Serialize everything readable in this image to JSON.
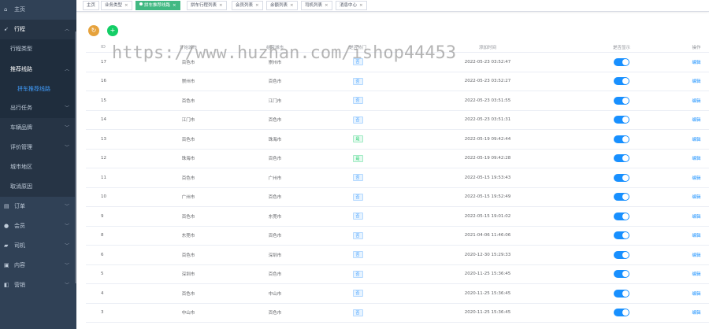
{
  "sidebar": {
    "items": [
      {
        "label": "主页",
        "icon": "home-icon",
        "chev": ""
      },
      {
        "label": "行程",
        "icon": "send-icon",
        "chev": "^"
      },
      {
        "label": "行程类型",
        "icon": "",
        "chev": ""
      },
      {
        "label": "推荐线路",
        "icon": "",
        "chev": "^"
      },
      {
        "label": "拼车推荐线路",
        "icon": "",
        "chev": ""
      },
      {
        "label": "出行任务",
        "icon": "",
        "chev": "v"
      },
      {
        "label": "车辆品牌",
        "icon": "",
        "chev": "v"
      },
      {
        "label": "评价管理",
        "icon": "",
        "chev": "v"
      },
      {
        "label": "城市地区",
        "icon": "",
        "chev": ""
      },
      {
        "label": "取消原因",
        "icon": "",
        "chev": ""
      },
      {
        "label": "订单",
        "icon": "order-icon",
        "chev": "v"
      },
      {
        "label": "会员",
        "icon": "user-icon",
        "chev": "v"
      },
      {
        "label": "司机",
        "icon": "driver-icon",
        "chev": "v"
      },
      {
        "label": "内容",
        "icon": "content-icon",
        "chev": "v"
      },
      {
        "label": "营销",
        "icon": "marketing-icon",
        "chev": "v"
      }
    ]
  },
  "tags": [
    {
      "label": "主页",
      "close": ""
    },
    {
      "label": "业务类型",
      "close": "×"
    },
    {
      "label": "拼车推荐线路",
      "close": "×"
    },
    {
      "label": "拼车行程列表",
      "close": "×"
    },
    {
      "label": "会员列表",
      "close": "×"
    },
    {
      "label": "余额列表",
      "close": "×"
    },
    {
      "label": "司机列表",
      "close": "×"
    },
    {
      "label": "消息中心",
      "close": "×"
    }
  ],
  "toolbar": {
    "refresh_icon": "↻",
    "add_icon": "+"
  },
  "table": {
    "headers": {
      "id": "ID",
      "from": "开始城市",
      "to": "结束城市",
      "hot": "是否热门",
      "time": "添加时间",
      "show": "是否显示",
      "op": "操作"
    },
    "rows": [
      {
        "id": "17",
        "from": "百色市",
        "to": "崇州市",
        "hot": "否",
        "time": "2022-05-23 03:52:47",
        "op": "编辑"
      },
      {
        "id": "16",
        "from": "崇州市",
        "to": "百色市",
        "hot": "否",
        "time": "2022-05-23 03:52:27",
        "op": "编辑"
      },
      {
        "id": "15",
        "from": "百色市",
        "to": "江门市",
        "hot": "否",
        "time": "2022-05-23 03:51:55",
        "op": "编辑"
      },
      {
        "id": "14",
        "from": "江门市",
        "to": "百色市",
        "hot": "否",
        "time": "2022-05-23 03:51:31",
        "op": "编辑"
      },
      {
        "id": "13",
        "from": "百色市",
        "to": "珠海市",
        "hot": "是",
        "time": "2022-05-19 09:42:44",
        "op": "编辑"
      },
      {
        "id": "12",
        "from": "珠海市",
        "to": "百色市",
        "hot": "是",
        "time": "2022-05-19 09:42:28",
        "op": "编辑"
      },
      {
        "id": "11",
        "from": "百色市",
        "to": "广州市",
        "hot": "否",
        "time": "2022-05-15 19:53:43",
        "op": "编辑"
      },
      {
        "id": "10",
        "from": "广州市",
        "to": "百色市",
        "hot": "否",
        "time": "2022-05-15 19:52:49",
        "op": "编辑"
      },
      {
        "id": "9",
        "from": "百色市",
        "to": "东莞市",
        "hot": "否",
        "time": "2022-05-15 19:01:02",
        "op": "编辑"
      },
      {
        "id": "8",
        "from": "东莞市",
        "to": "百色市",
        "hot": "否",
        "time": "2021-04-06 11:46:06",
        "op": "编辑"
      },
      {
        "id": "6",
        "from": "百色市",
        "to": "深圳市",
        "hot": "否",
        "time": "2020-12-30 15:29:33",
        "op": "编辑"
      },
      {
        "id": "5",
        "from": "深圳市",
        "to": "百色市",
        "hot": "否",
        "time": "2020-11-25 15:36:45",
        "op": "编辑"
      },
      {
        "id": "4",
        "from": "百色市",
        "to": "中山市",
        "hot": "否",
        "time": "2020-11-25 15:36:45",
        "op": "编辑"
      },
      {
        "id": "3",
        "from": "中山市",
        "to": "百色市",
        "hot": "否",
        "time": "2020-11-25 15:36:45",
        "op": "编辑"
      }
    ]
  },
  "watermark": "https://www.huzhan.com/ishop44453",
  "colors": {
    "sidebar_bg": "#304156",
    "active_tag": "#42b983",
    "switch_on": "#1890ff",
    "link": "#1890ff"
  }
}
